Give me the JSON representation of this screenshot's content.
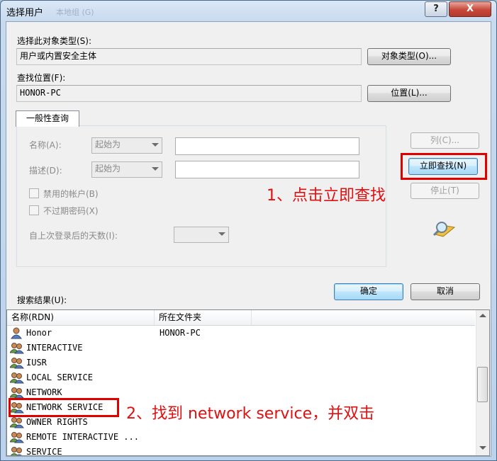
{
  "window": {
    "title": "选择用户",
    "ghost_title": "本地组 (G)",
    "help": "?",
    "close": "X"
  },
  "object_type": {
    "label": "选择此对象类型(S):",
    "value": "用户或内置安全主体",
    "button": "对象类型(O)..."
  },
  "location": {
    "label": "查找位置(F):",
    "value": "HONOR-PC",
    "button": "位置(L)..."
  },
  "query": {
    "tab": "一般性查询",
    "name_label": "名称(A):",
    "name_mode": "起始为",
    "desc_label": "描述(D):",
    "desc_mode": "起始为",
    "disabled_accounts": "禁用的帐户(B)",
    "non_expiring_pw": "不过期密码(X)",
    "days_label": "自上次登录后的天数(I):"
  },
  "buttons": {
    "columns": "列(C)...",
    "find_now": "立即查找(N)",
    "stop": "停止(T)",
    "ok": "确定",
    "cancel": "取消"
  },
  "results": {
    "label": "搜索结果(U):",
    "columns": [
      "名称(RDN)",
      "所在文件夹"
    ],
    "rows": [
      {
        "name": "Honor",
        "folder": "HONOR-PC",
        "icon": "single-user-icon"
      },
      {
        "name": "INTERACTIVE",
        "folder": "",
        "icon": "user-group-icon"
      },
      {
        "name": "IUSR",
        "folder": "",
        "icon": "user-group-icon"
      },
      {
        "name": "LOCAL SERVICE",
        "folder": "",
        "icon": "user-group-icon"
      },
      {
        "name": "NETWORK",
        "folder": "",
        "icon": "user-group-icon"
      },
      {
        "name": "NETWORK SERVICE",
        "folder": "",
        "icon": "user-group-icon"
      },
      {
        "name": "OWNER RIGHTS",
        "folder": "",
        "icon": "user-group-icon"
      },
      {
        "name": "REMOTE INTERACTIVE ...",
        "folder": "",
        "icon": "user-group-icon"
      },
      {
        "name": "SERVICE",
        "folder": "",
        "icon": "user-group-icon"
      }
    ]
  },
  "annotations": {
    "step1": "1、点击立即查找",
    "step2": "2、找到 network service，并双击"
  },
  "colors": {
    "annotation": "#e00000",
    "accent": "#3c7fb1"
  }
}
